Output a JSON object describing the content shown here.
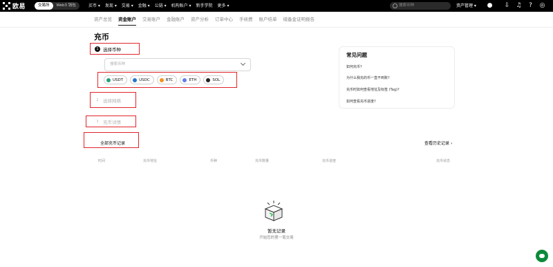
{
  "topbar": {
    "logo_text": "欧易",
    "segments": [
      {
        "label": "交易所",
        "active": true
      },
      {
        "label": "Web3 钱包",
        "active": false
      }
    ],
    "nav": [
      "买币 ▾",
      "发现 ▾",
      "交易 ▾",
      "金融 ▾",
      "公链 ▾",
      "机构账户 ▾",
      "新手学院",
      "更多 ▾"
    ],
    "search_placeholder": "搜索币种",
    "asset_label": "资产管理 ▾",
    "icons": [
      "user-icon",
      "download-icon",
      "bell-icon",
      "help-icon",
      "globe-icon"
    ]
  },
  "subnav": [
    {
      "label": "资产总览",
      "active": false
    },
    {
      "label": "资金账户",
      "active": true
    },
    {
      "label": "交易账户",
      "active": false
    },
    {
      "label": "金融账户",
      "active": false
    },
    {
      "label": "资产分析",
      "active": false
    },
    {
      "label": "订单中心",
      "active": false
    },
    {
      "label": "手续费",
      "active": false
    },
    {
      "label": "账户结单",
      "active": false
    },
    {
      "label": "储备金证明报告",
      "active": false
    }
  ],
  "page_title": "充币",
  "steps": [
    {
      "num": "1",
      "label": "选择币种"
    },
    {
      "num": "2",
      "label": "选择网络"
    },
    {
      "num": "3",
      "label": "充币详情"
    }
  ],
  "coin_select": {
    "placeholder": "搜索币种"
  },
  "coins": [
    {
      "label": "USDT",
      "color": "#26a17b"
    },
    {
      "label": "USDC",
      "color": "#2775ca"
    },
    {
      "label": "BTC",
      "color": "#f7931a"
    },
    {
      "label": "ETH",
      "color": "#627eea"
    },
    {
      "label": "SOL",
      "color": "#222222"
    }
  ],
  "history": {
    "title": "全部充币记录",
    "view_all": "查看历史记录",
    "columns": [
      "时间",
      "充币地址",
      "币种",
      "充币数量",
      "充币进度",
      "充币状态"
    ]
  },
  "empty": {
    "title": "暂无记录",
    "subtitle": "开始您的第一笔交易"
  },
  "faq": {
    "title": "常见问题",
    "items": [
      "如何充币?",
      "为什么我充的币一直不到账?",
      "充币时如何查看地址及标签 (Tag)?",
      "如何查看充币进度?"
    ]
  },
  "colors": {
    "accent": "#000000",
    "highlight_box": "#e0242a",
    "chat_button": "#0b8a3a"
  }
}
